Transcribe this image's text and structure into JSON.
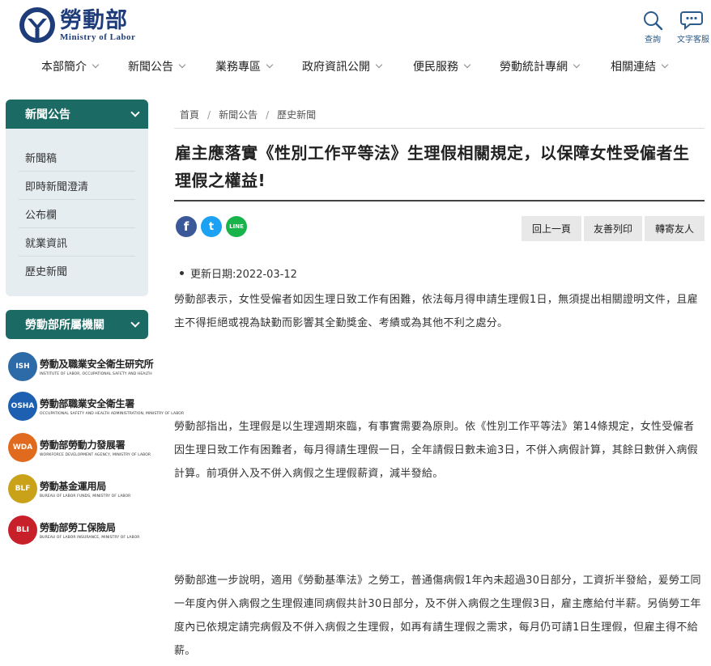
{
  "header": {
    "logo_zh": "勞動部",
    "logo_en": "Ministry of Labor",
    "search_label": "查詢",
    "text_service_label": "文字客服"
  },
  "nav": [
    {
      "label": "本部簡介"
    },
    {
      "label": "新聞公告"
    },
    {
      "label": "業務專區"
    },
    {
      "label": "政府資訊公開"
    },
    {
      "label": "便民服務"
    },
    {
      "label": "勞動統計專網"
    },
    {
      "label": "相關連結"
    }
  ],
  "sidebar": {
    "news": {
      "title": "新聞公告",
      "items": [
        {
          "label": "新聞稿"
        },
        {
          "label": "即時新聞澄清"
        },
        {
          "label": "公布欄"
        },
        {
          "label": "就業資訊"
        },
        {
          "label": "歷史新聞"
        }
      ]
    },
    "agencies": {
      "title": "勞動部所屬機關",
      "items": [
        {
          "abbr": "ISH",
          "name": "勞動及職業安全衛生研究所",
          "en": "INSTITUTE OF LABOR, OCCUPATIONAL SAFETY AND HEALTH",
          "color": "#2d6aa8"
        },
        {
          "abbr": "OSHA",
          "name": "勞動部職業安全衛生署",
          "en": "OCCUPATIONAL SAFETY AND HEALTH ADMINISTRATION, MINISTRY OF LABOR",
          "color": "#1d5fb0"
        },
        {
          "abbr": "WDA",
          "name": "勞動部勞動力發展署",
          "en": "WORKFORCE DEVELOPMENT AGENCY, MINISTRY OF LABOR",
          "color": "#e06a1e"
        },
        {
          "abbr": "BLF",
          "name": "勞動基金運用局",
          "en": "BUREAU OF LABOR FUNDS, MINISTRY OF LABOR",
          "color": "#c9a21a"
        },
        {
          "abbr": "BLI",
          "name": "勞動部勞工保險局",
          "en": "BUREAU OF LABOR INSURANCE, MINISTRY OF LABOR",
          "color": "#c8202a"
        }
      ]
    }
  },
  "breadcrumb": [
    "首頁",
    "新聞公告",
    "歷史新聞"
  ],
  "article": {
    "title": "雇主應落實《性別工作平等法》生理假相關規定，以保障女性受僱者生理假之權益!",
    "update_date": "更新日期:2022-03-12",
    "paragraphs": [
      "勞動部表示，女性受僱者如因生理日致工作有困難，依法每月得申請生理假1日，無須提出相關證明文件，且雇主不得拒絕或視為缺勤而影響其全勤獎金、考績或為其他不利之處分。",
      "勞動部指出，生理假是以生理週期來臨，有事實需要為原則。依《性別工作平等法》第14條規定，女性受僱者因生理日致工作有困難者，每月得請生理假一日，全年請假日數未逾3日，不併入病假計算，其餘日數併入病假計算。前項併入及不併入病假之生理假薪資，減半發給。",
      "勞動部進一步說明，適用《勞動基準法》之勞工，普通傷病假1年內未超過30日部分，工資折半發給，爰勞工同一年度內併入病假之生理假連同病假共計30日部分，及不併入病假之生理假3日，雇主應給付半薪。另倘勞工年度內已依規定請完病假及不併入病假之生理假，如再有請生理假之需求，每月仍可請1日生理假，但雇主得不給薪。"
    ]
  },
  "share": {
    "fb": "f",
    "tw": "t",
    "line": "LINE"
  },
  "actions": {
    "back": "回上一頁",
    "print": "友善列印",
    "forward": "轉寄友人"
  }
}
